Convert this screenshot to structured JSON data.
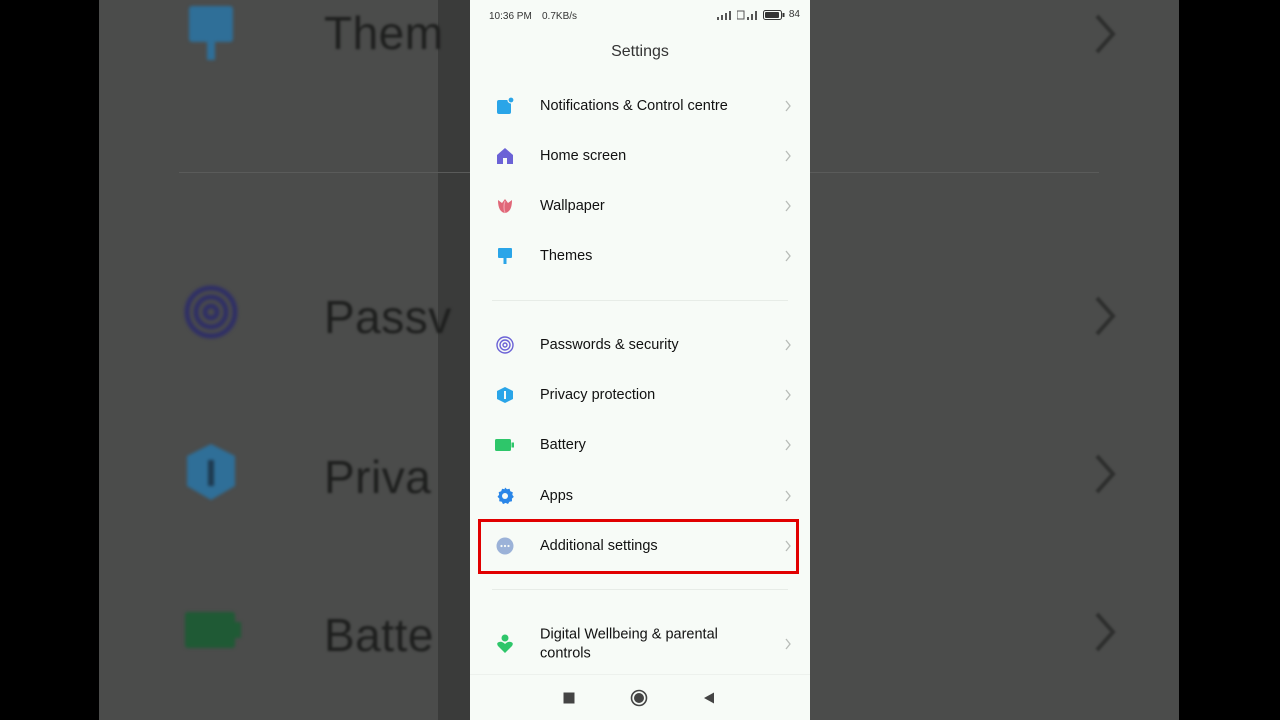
{
  "status_bar": {
    "time": "10:36 PM",
    "speed": "0.7KB/s",
    "battery": "84"
  },
  "header": {
    "title": "Settings"
  },
  "groups": [
    {
      "items": [
        {
          "label": "Notifications & Control centre",
          "icon": "notification-icon",
          "color": "#2aa5e8"
        },
        {
          "label": "Home screen",
          "icon": "home-icon",
          "color": "#6b62d6"
        },
        {
          "label": "Wallpaper",
          "icon": "tulip-icon",
          "color": "#e06778"
        },
        {
          "label": "Themes",
          "icon": "paintbrush-icon",
          "color": "#2aa5e8"
        }
      ]
    },
    {
      "items": [
        {
          "label": "Passwords & security",
          "icon": "fingerprint-icon",
          "color": "#6b62d6"
        },
        {
          "label": "Privacy protection",
          "icon": "shield-icon",
          "color": "#2aa5e8"
        },
        {
          "label": "Battery",
          "icon": "battery-icon",
          "color": "#2ec66a"
        },
        {
          "label": "Apps",
          "icon": "gear-icon",
          "color": "#2a86e8"
        },
        {
          "label": "Additional settings",
          "icon": "more-icon",
          "color": "#9bb2d8"
        }
      ]
    },
    {
      "items": [
        {
          "label": "Digital Wellbeing & parental controls",
          "icon": "wellbeing-icon",
          "color": "#2ec66a"
        }
      ]
    }
  ],
  "highlighted_item": "Additional settings",
  "background_mirror": {
    "labels": [
      "Them",
      "Passv",
      "Priva",
      "Batte"
    ]
  },
  "nav": [
    "recents-button",
    "home-button",
    "back-button"
  ]
}
